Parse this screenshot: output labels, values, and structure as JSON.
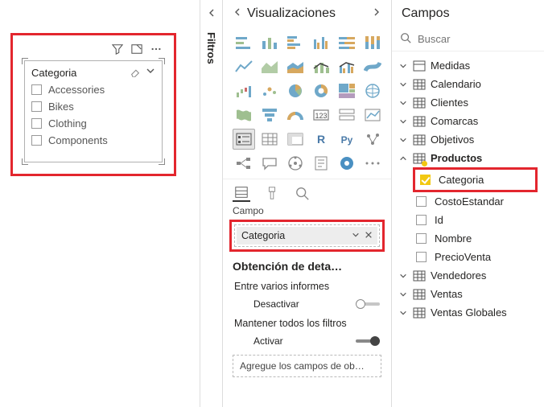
{
  "canvas": {
    "visual_title": "Categoria",
    "slicer_items": [
      "Accessories",
      "Bikes",
      "Clothing",
      "Components"
    ]
  },
  "filters": {
    "label": "Filtros"
  },
  "viz": {
    "title": "Visualizaciones",
    "field_section": "Campo",
    "field_pill": "Categoria",
    "drill_header": "Obtención de deta…",
    "cross_report": "Entre varios informes",
    "deactivate": "Desactivar",
    "keep_filters": "Mantener todos los filtros",
    "activate": "Activar",
    "drop_hint": "Agregue los campos de ob…"
  },
  "fields": {
    "title": "Campos",
    "search_placeholder": "Buscar",
    "tables": {
      "medidas": "Medidas",
      "calendario": "Calendario",
      "clientes": "Clientes",
      "comarcas": "Comarcas",
      "objetivos": "Objetivos",
      "productos": "Productos",
      "vendedores": "Vendedores",
      "ventas": "Ventas",
      "ventas_globales": "Ventas Globales"
    },
    "productos_fields": {
      "categoria": "Categoria",
      "costoestandar": "CostoEstandar",
      "id": "Id",
      "nombre": "Nombre",
      "precioventa": "PrecioVenta"
    }
  }
}
